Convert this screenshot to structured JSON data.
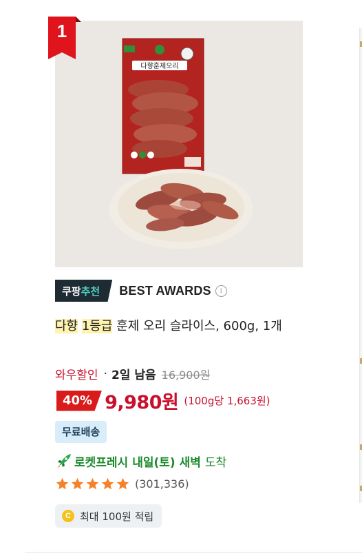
{
  "product": {
    "rank": "1",
    "pick_label_white": "쿠팡",
    "pick_label_green": "추천",
    "awards_label": "BEST AWARDS",
    "title_hl1": "다향",
    "title_hl2": "1등급",
    "title_rest": "훈제 오리 슬라이스, 600g, 1개",
    "discount_label": "와우할인",
    "days_left": "2일 남음",
    "original_price": "16,900원",
    "discount_percent": "40%",
    "sale_price": "9,980원",
    "unit_price": "(100g당 1,663원)",
    "free_shipping": "무료배송",
    "rocket_label": "로켓프레시",
    "delivery_day": "내일(토) 새벽",
    "delivery_suffix": "도착",
    "rating": 5,
    "review_count": "(301,336)",
    "points_coin": "C",
    "points_text": "최대 100원 적립",
    "package_brand": "다향훈제오리"
  },
  "colors": {
    "accent_red": "#c8102e",
    "rank_red": "#e0141d",
    "rocket_green": "#1a8a2a",
    "star_orange": "#f5822a",
    "pick_dark": "#1f2b33"
  }
}
